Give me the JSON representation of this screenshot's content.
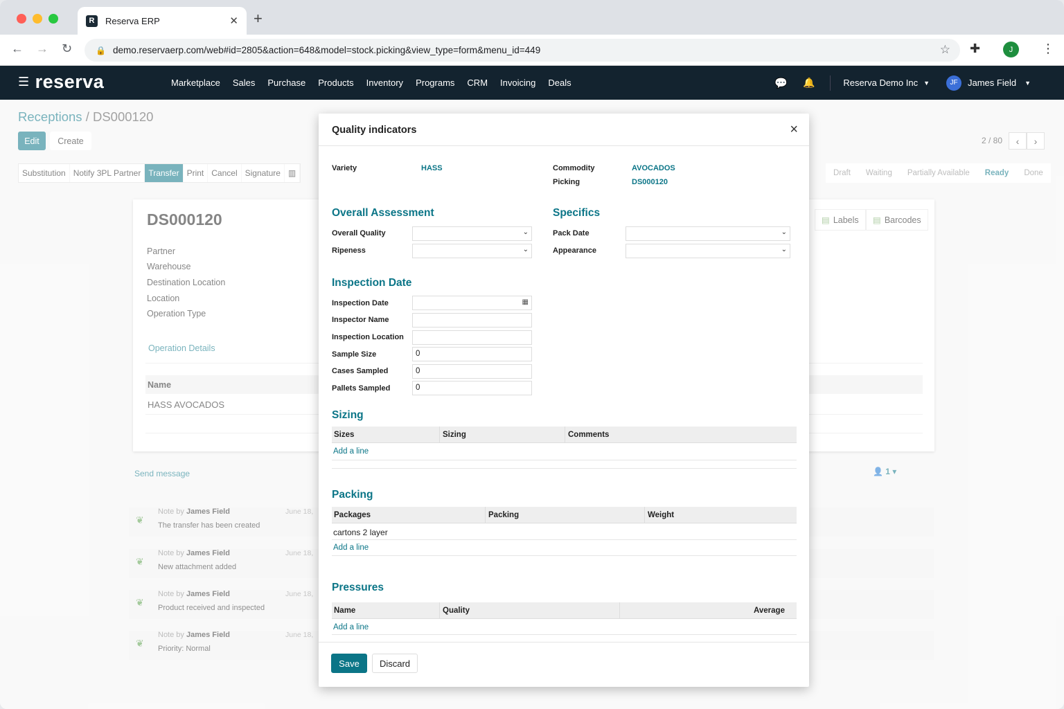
{
  "browser": {
    "tab_title": "Reserva ERP",
    "favicon_letter": "R",
    "url": "demo.reservaerp.com/web#id=2805&action=648&model=stock.picking&view_type=form&menu_id=449",
    "profile_initial": "J"
  },
  "nav": {
    "brand": "reserva",
    "menu": [
      "Marketplace",
      "Sales",
      "Purchase",
      "Products",
      "Inventory",
      "Programs",
      "CRM",
      "Invoicing",
      "Deals"
    ],
    "company": "Reserva Demo Inc",
    "user_initials": "JF",
    "user_name": "James Field"
  },
  "page": {
    "breadcrumb_parent": "Receptions",
    "breadcrumb_sep": "/",
    "breadcrumb_current": "DS000120",
    "edit_label": "Edit",
    "create_label": "Create",
    "actions": [
      "Substitution",
      "Notify 3PL Partner",
      "Transfer",
      "Print",
      "Cancel",
      "Signature",
      "▥"
    ],
    "pager": "2 / 80",
    "statuses": [
      "Draft",
      "Waiting",
      "Partially Available",
      "Ready",
      "Done"
    ],
    "current_status": "Ready"
  },
  "sheet": {
    "title": "DS000120",
    "labels": [
      "Partner",
      "Warehouse",
      "Destination Location",
      "Location",
      "Operation Type"
    ],
    "operation_details": "Operation Details",
    "col_name": "Name",
    "row_name": "HASS AVOCADOS",
    "labels_btn": "Labels",
    "barcodes_btn": "Barcodes"
  },
  "chatter": {
    "send_message": "Send message",
    "followers": "1",
    "messages": [
      {
        "by_prefix": "Note by",
        "author": "James Field",
        "date": "June 18,",
        "body": "The transfer has been created"
      },
      {
        "by_prefix": "Note by",
        "author": "James Field",
        "date": "June 18,",
        "body": "New attachment added"
      },
      {
        "by_prefix": "Note by",
        "author": "James Field",
        "date": "June 18,",
        "body": "Product received and inspected"
      },
      {
        "by_prefix": "Note by",
        "author": "James Field",
        "date": "June 18,",
        "body": "Priority: Normal"
      }
    ]
  },
  "modal": {
    "title": "Quality indicators",
    "variety_label": "Variety",
    "variety_value": "HASS",
    "commodity_label": "Commodity",
    "commodity_value": "AVOCADOS",
    "picking_label": "Picking",
    "picking_value": "DS000120",
    "overall_title": "Overall Assessment",
    "overall_quality_label": "Overall Quality",
    "ripeness_label": "Ripeness",
    "specifics_title": "Specifics",
    "pack_date_label": "Pack Date",
    "appearance_label": "Appearance",
    "inspection_title": "Inspection Date",
    "inspection_date_label": "Inspection Date",
    "inspector_name_label": "Inspector Name",
    "inspection_location_label": "Inspection Location",
    "sample_size_label": "Sample Size",
    "sample_size_value": "0",
    "cases_sampled_label": "Cases Sampled",
    "cases_sampled_value": "0",
    "pallets_sampled_label": "Pallets Sampled",
    "pallets_sampled_value": "0",
    "sizing_title": "Sizing",
    "sizing_cols": [
      "Sizes",
      "Sizing",
      "Comments"
    ],
    "packing_title": "Packing",
    "packing_cols": [
      "Packages",
      "Packing",
      "Weight"
    ],
    "packing_row": "cartons 2 layer",
    "pressures_title": "Pressures",
    "pressures_cols": [
      "Name",
      "Quality",
      "Average"
    ],
    "add_line": "Add a line",
    "save_label": "Save",
    "discard_label": "Discard"
  }
}
